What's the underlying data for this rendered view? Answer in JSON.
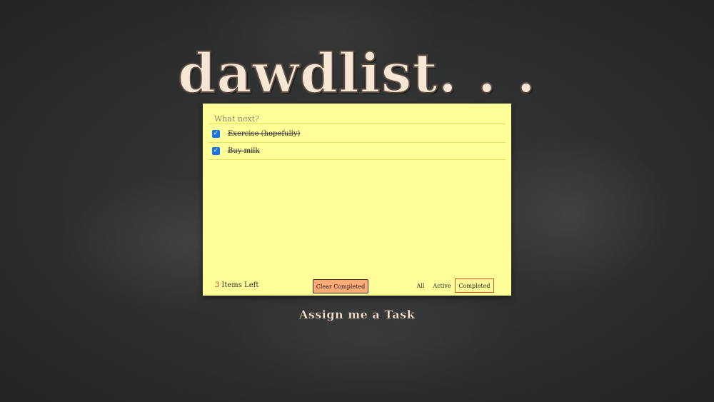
{
  "app": {
    "title": "dawdlist. . .",
    "tagline": "Assign me a Task"
  },
  "new_task": {
    "placeholder": "What next?",
    "value": ""
  },
  "tasks": [
    {
      "text": "Exercise (hopefully)",
      "completed": true
    },
    {
      "text": "Buy milk",
      "completed": true
    }
  ],
  "footer": {
    "items_left_count": "3",
    "items_left_label": "Items Left",
    "clear_label": "Clear Completed",
    "filters": {
      "all": "All",
      "active": "Active",
      "completed": "Completed"
    },
    "selected_filter": "Completed"
  },
  "icons": {
    "checkbox_checked": "check-icon"
  },
  "colors": {
    "card_background": "#ffff99",
    "clear_button": "#ffaa77",
    "selected_filter_border": "#e05030",
    "count_text": "#d02020",
    "checkbox": "#1a73e8"
  }
}
